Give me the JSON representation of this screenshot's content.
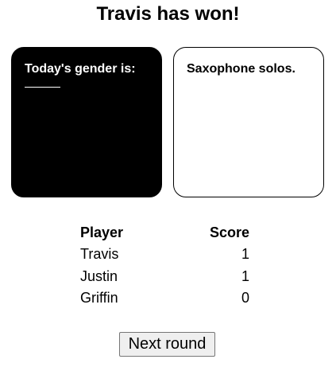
{
  "header": {
    "title": "Travis has won!"
  },
  "cards": {
    "black_card_text": "Today's gender is:",
    "white_card_text": "Saxophone solos."
  },
  "scoreboard": {
    "headers": {
      "player": "Player",
      "score": "Score"
    },
    "rows": [
      {
        "player": "Travis",
        "score": "1"
      },
      {
        "player": "Justin",
        "score": "1"
      },
      {
        "player": "Griffin",
        "score": "0"
      }
    ]
  },
  "actions": {
    "next_round_label": "Next round"
  },
  "colors": {
    "black_card": "#000000",
    "white_card": "#ffffff"
  }
}
